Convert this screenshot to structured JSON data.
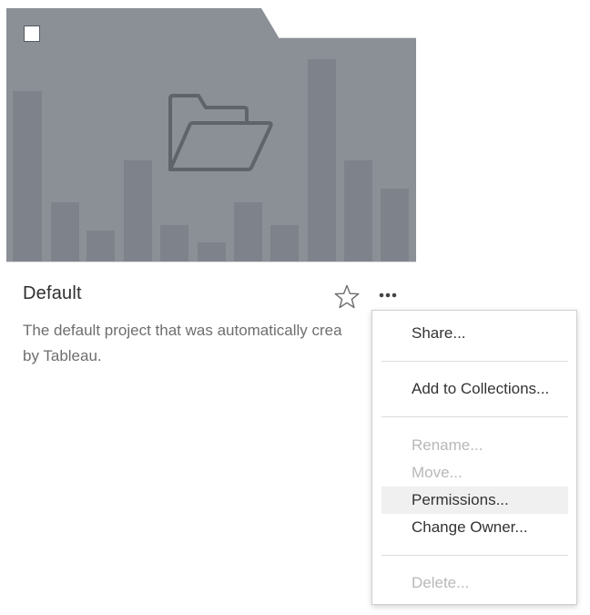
{
  "card": {
    "title": "Default",
    "description_line1": "The default project that was automatically crea",
    "description_line2": "by Tableau.",
    "thumbnail_color": "#8b8f96",
    "bar_color": "#7e828a",
    "icons": {
      "folder": "open-folder-icon",
      "favorite": "star-outline-icon",
      "more": "more-actions-icon",
      "select": "checkbox-unchecked"
    }
  },
  "menu": {
    "items": [
      {
        "label": "Share...",
        "enabled": true
      },
      {
        "label": "Add to Collections...",
        "enabled": true
      },
      {
        "label": "Rename...",
        "enabled": false
      },
      {
        "label": "Move...",
        "enabled": false
      },
      {
        "label": "Permissions...",
        "enabled": true,
        "hovered": true
      },
      {
        "label": "Change Owner...",
        "enabled": true
      },
      {
        "label": "Delete...",
        "enabled": false
      }
    ]
  }
}
